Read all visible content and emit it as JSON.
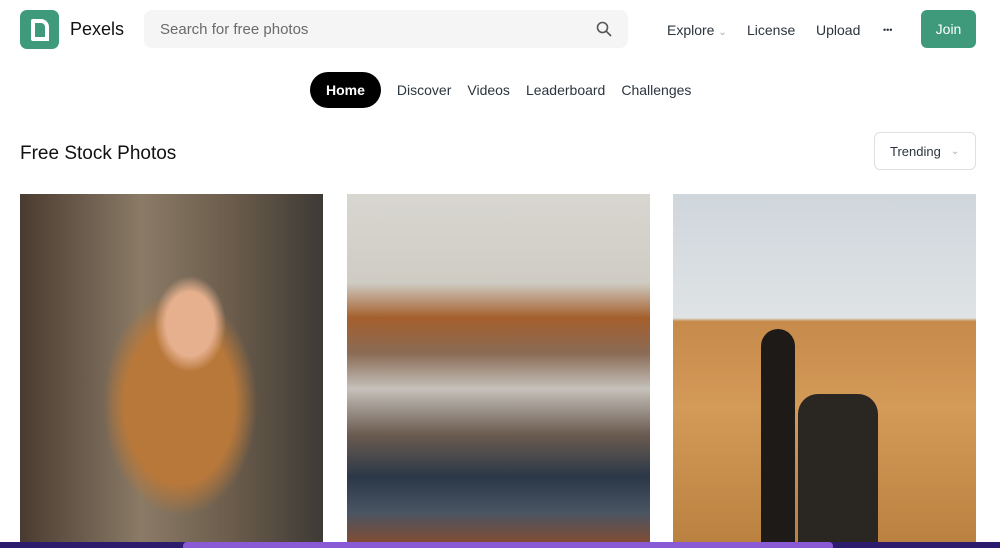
{
  "header": {
    "brand": "Pexels",
    "search_placeholder": "Search for free photos",
    "nav": {
      "explore": "Explore",
      "license": "License",
      "upload": "Upload",
      "more": "•••"
    },
    "join": "Join",
    "accent_color": "#3f9a7c"
  },
  "tabs": [
    {
      "label": "Home",
      "active": true
    },
    {
      "label": "Discover"
    },
    {
      "label": "Videos"
    },
    {
      "label": "Leaderboard"
    },
    {
      "label": "Challenges"
    }
  ],
  "main": {
    "title": "Free Stock Photos",
    "sort": "Trending"
  }
}
